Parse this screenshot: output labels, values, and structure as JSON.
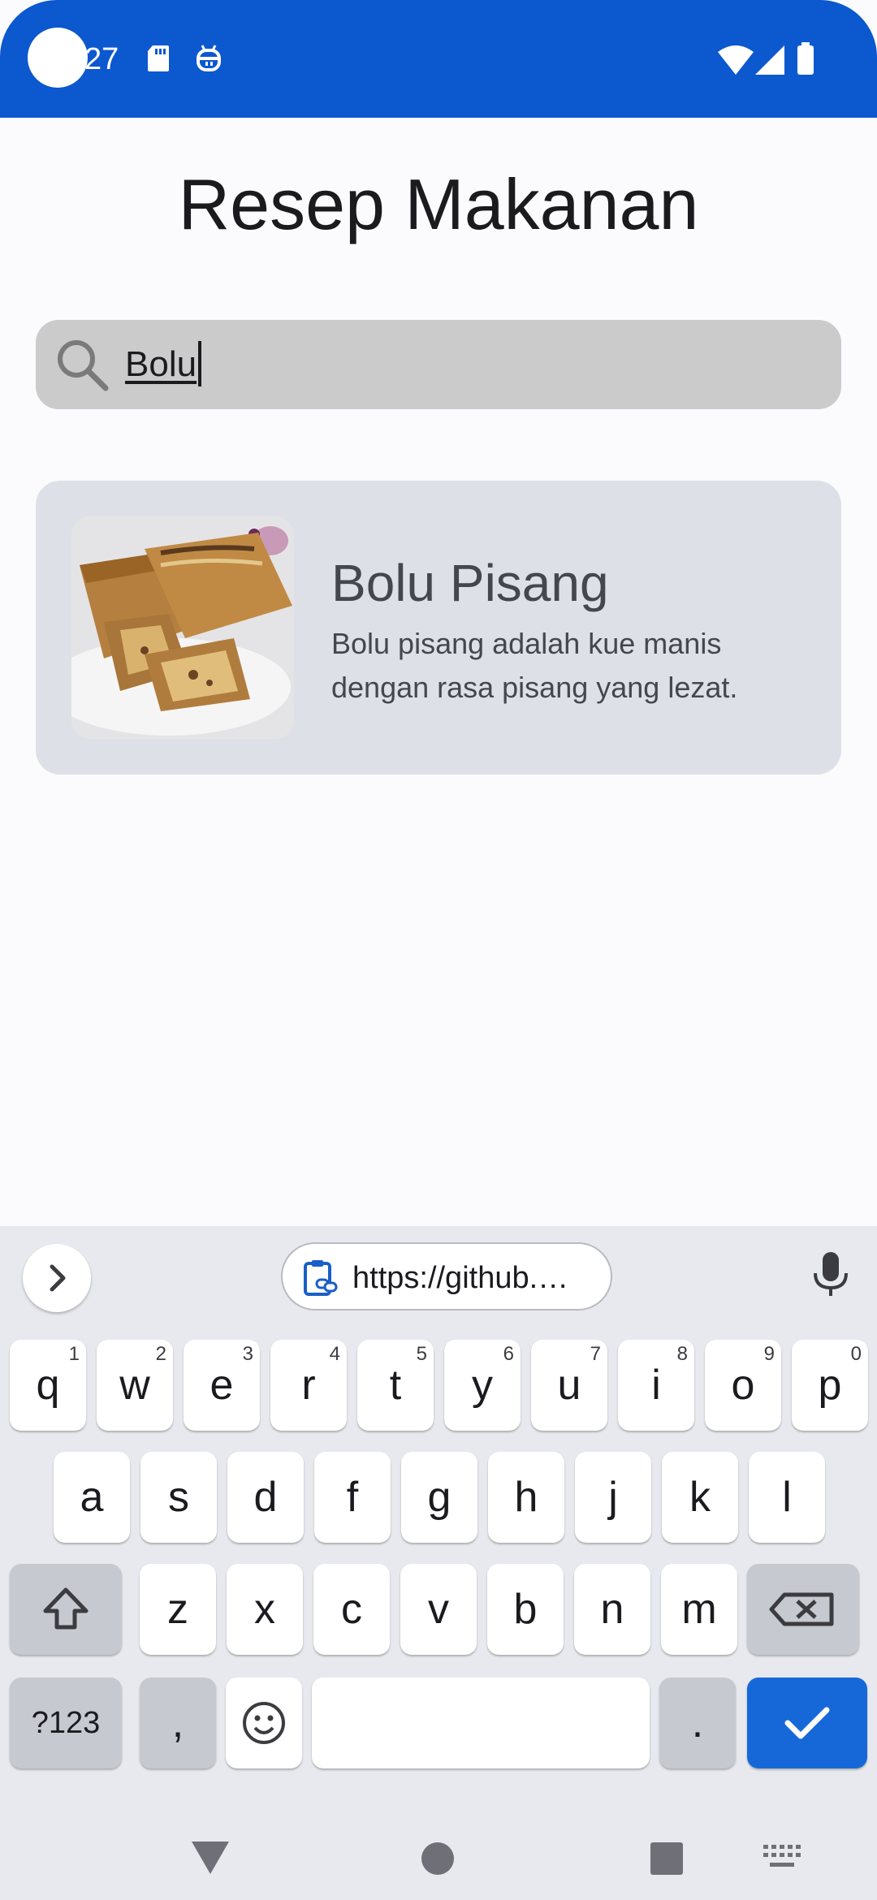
{
  "status_bar": {
    "time": "27",
    "icons": [
      "sd-card-icon",
      "usb-debug-icon",
      "wifi-icon",
      "signal-icon",
      "battery-icon"
    ]
  },
  "app": {
    "title": "Resep Makanan"
  },
  "search": {
    "value": "Bolu",
    "icon": "search-icon"
  },
  "results": [
    {
      "title": "Bolu Pisang",
      "description": "Bolu pisang adalah kue manis dengan rasa pisang yang lezat.",
      "image": "banana-cake-photo"
    }
  ],
  "keyboard": {
    "clipboard_suggestion": "https://github.…",
    "row1": [
      {
        "k": "q",
        "h": "1"
      },
      {
        "k": "w",
        "h": "2"
      },
      {
        "k": "e",
        "h": "3"
      },
      {
        "k": "r",
        "h": "4"
      },
      {
        "k": "t",
        "h": "5"
      },
      {
        "k": "y",
        "h": "6"
      },
      {
        "k": "u",
        "h": "7"
      },
      {
        "k": "i",
        "h": "8"
      },
      {
        "k": "o",
        "h": "9"
      },
      {
        "k": "p",
        "h": "0"
      }
    ],
    "row2": [
      "a",
      "s",
      "d",
      "f",
      "g",
      "h",
      "j",
      "k",
      "l"
    ],
    "row3": [
      "z",
      "x",
      "c",
      "v",
      "b",
      "n",
      "m"
    ],
    "symbols_label": "?123",
    "comma_label": ",",
    "period_label": "."
  },
  "colors": {
    "status_bar": "#0c58ce",
    "search_bg": "#cbcbcb",
    "card_bg": "#dde1e7",
    "enter_key": "#1668d9"
  }
}
